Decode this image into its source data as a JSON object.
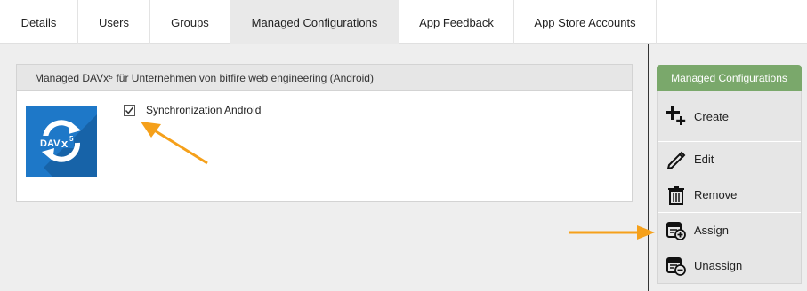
{
  "tabs": [
    {
      "label": "Details"
    },
    {
      "label": "Users"
    },
    {
      "label": "Groups"
    },
    {
      "label": "Managed Configurations",
      "active": true
    },
    {
      "label": "App Feedback"
    },
    {
      "label": "App Store Accounts"
    }
  ],
  "panel": {
    "title": "Managed DAVx⁵ für Unternehmen von bitfire web engineering (Android)",
    "app_icon_text": "DAVx5",
    "configuration": {
      "label": "Synchronization Android",
      "checked": true
    }
  },
  "sidebar": {
    "header": "Managed Configurations",
    "actions": [
      {
        "label": "Create",
        "icon": "create-icon"
      },
      {
        "label": "Edit",
        "icon": "pencil-icon"
      },
      {
        "label": "Remove",
        "icon": "trash-icon"
      },
      {
        "label": "Assign",
        "icon": "assign-icon"
      },
      {
        "label": "Unassign",
        "icon": "unassign-icon"
      }
    ]
  },
  "colors": {
    "accent_green": "#7aa86b",
    "app_icon_blue": "#1e78c8",
    "annotation_orange": "#f5a01a"
  }
}
